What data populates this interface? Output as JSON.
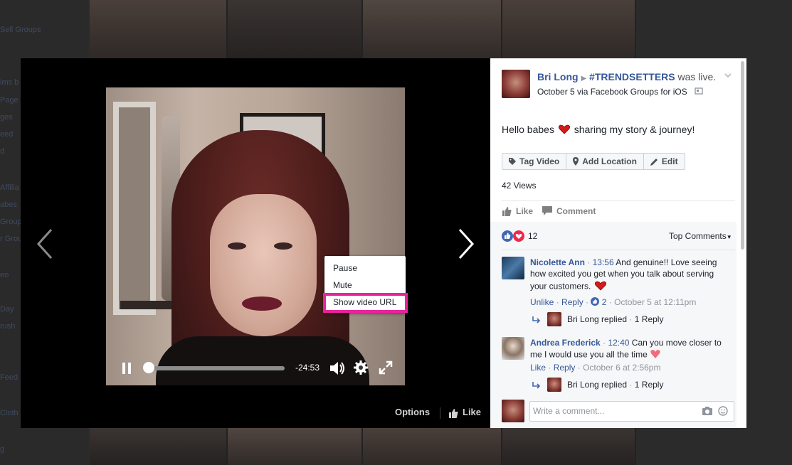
{
  "background": {
    "sidebar_items": [
      "Sell Groups",
      "ims b",
      "Page",
      "ges",
      "eed",
      "d",
      "Affilia",
      "abes",
      "Group",
      "r Grou",
      "eo",
      "Day",
      "rush",
      "Feed",
      "Cloth",
      "g"
    ]
  },
  "post": {
    "author": "Bri Long",
    "group": "#TRENDSETTERS",
    "status": "was live.",
    "meta": "October 5 via Facebook Groups for iOS",
    "message_before": "Hello babes",
    "message_after": "sharing my story & journey!",
    "views": "42 Views",
    "actions": {
      "tag": "Tag Video",
      "location": "Add Location",
      "edit": "Edit"
    },
    "like_label": "Like",
    "comment_label": "Comment",
    "reaction_count": "12",
    "sort_label": "Top Comments"
  },
  "comments": [
    {
      "author": "Nicolette Ann",
      "time": "13:56",
      "text_line1": "And genuine!! Love seeing",
      "text_line2": "how excited you get when you talk about serving",
      "text_line3": "your customers.",
      "action1": "Unlike",
      "action2": "Reply",
      "likes": "2",
      "date": "October 5 at 12:11pm",
      "reply_author": "Bri Long",
      "reply_verb": "replied",
      "reply_count": "1 Reply"
    },
    {
      "author": "Andrea Frederick",
      "time": "12:40",
      "text_line1": "Can you move closer to",
      "text_line2": "me I would use you all the time",
      "action1": "Like",
      "action2": "Reply",
      "date": "October 6 at 2:56pm",
      "reply_author": "Bri Long",
      "reply_verb": "replied",
      "reply_count": "1 Reply"
    }
  ],
  "composer": {
    "placeholder": "Write a comment..."
  },
  "player": {
    "time_remaining": "-24:53",
    "progress": 0
  },
  "context_menu": [
    "Pause",
    "Mute",
    "Show video URL"
  ],
  "footer": {
    "options": "Options",
    "like": "Like"
  },
  "colors": {
    "link": "#365899",
    "highlight": "#e8239c",
    "theater": "#000000"
  }
}
